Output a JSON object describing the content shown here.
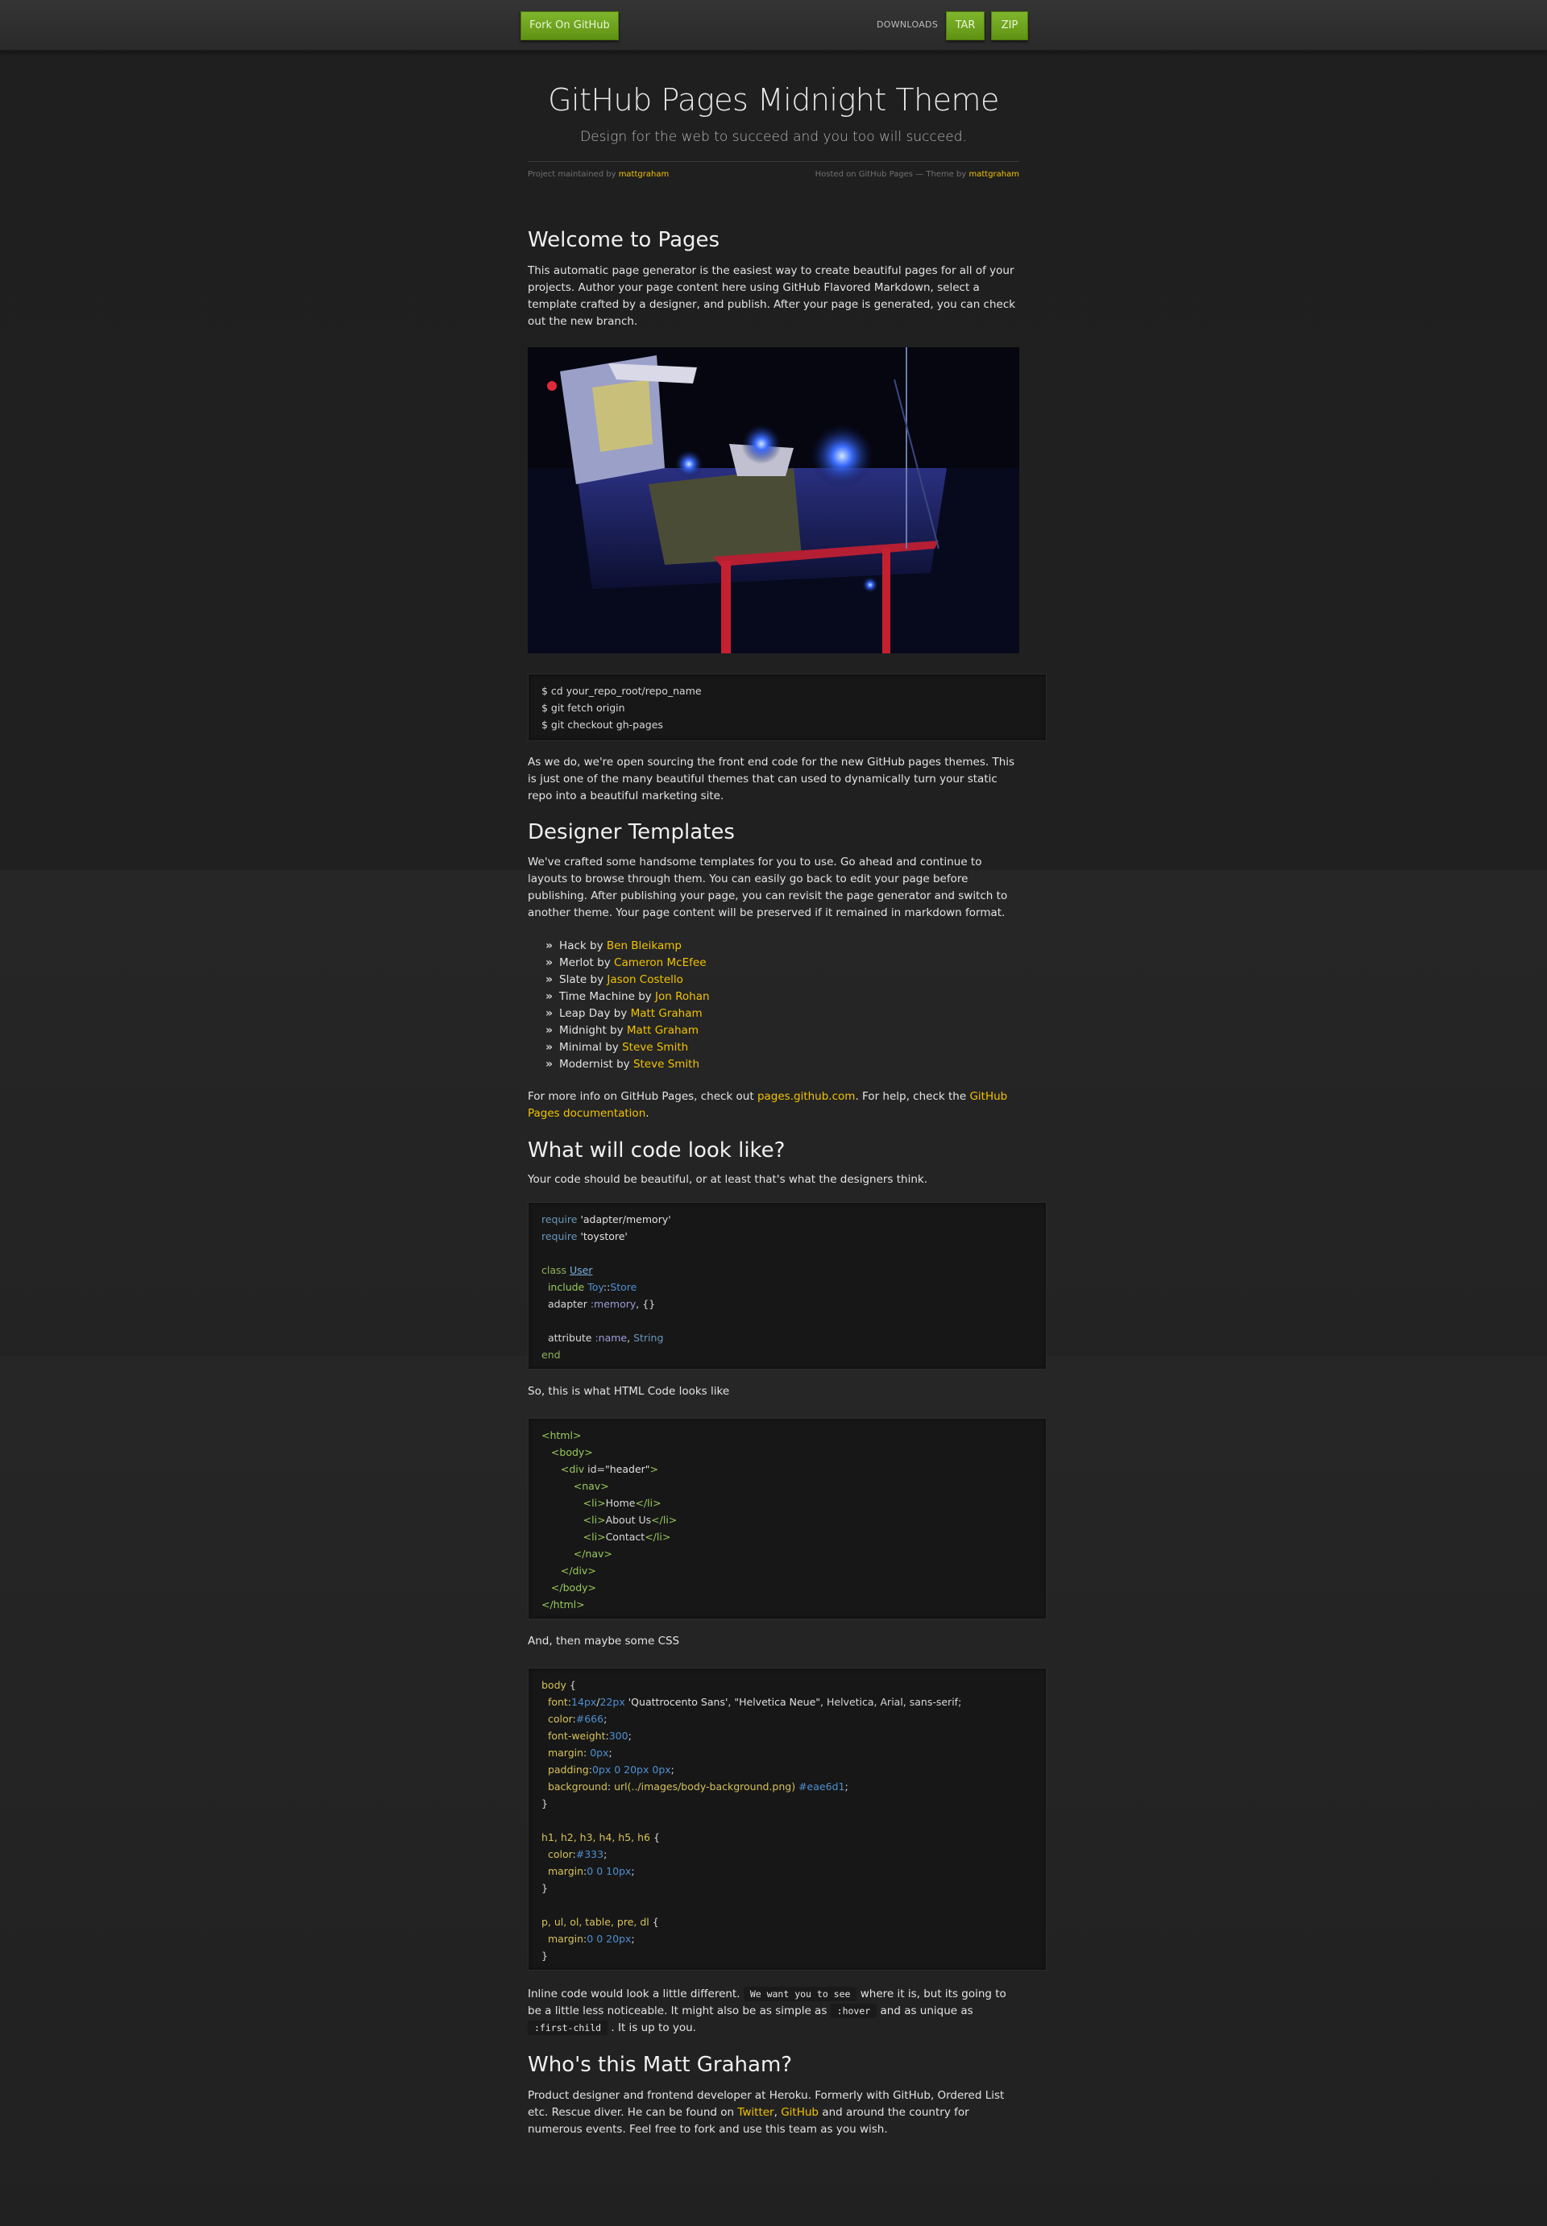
{
  "nav": {
    "fork_label": "Fork On GitHub",
    "downloads_label": "DOWNLOADS",
    "tar_label": "TAR",
    "zip_label": "ZIP"
  },
  "header": {
    "title": "GitHub Pages Midnight Theme",
    "subtitle": "Design for the web to succeed and you too will succeed.",
    "maintained_prefix": "Project maintained by",
    "maintainer": "mattgraham",
    "hosted_text": "Hosted on GitHub Pages — Theme by",
    "theme_author": "mattgraham"
  },
  "welcome": {
    "heading": "Welcome to Pages",
    "body": "This automatic page generator is the easiest way to create beautiful pages for all of your projects. Author your page content here using GitHub Flavored Markdown, select a template crafted by a designer, and publish. After your page is generated, you can check out the new branch."
  },
  "git_commands": [
    "$ cd your_repo_root/repo_name",
    "$ git fetch origin",
    "$ git checkout gh-pages"
  ],
  "open_source_text": "As we do, we're open sourcing the front end code for the new GitHub pages themes. This is just one of the many beautiful themes that can used to dynamically turn your static repo into a beautiful marketing site.",
  "designer": {
    "heading": "Designer Templates",
    "body": "We've crafted some handsome templates for you to use. Go ahead and continue to layouts to browse through them. You can easily go back to edit your page before publishing. After publishing your page, you can revisit the page generator and switch to another theme. Your page content will be preserved if it remained in markdown format.",
    "themes": [
      {
        "name": "Hack",
        "by": "by",
        "author": "Ben Bleikamp"
      },
      {
        "name": "Merlot",
        "by": "by",
        "author": "Cameron McEfee"
      },
      {
        "name": "Slate",
        "by": "by",
        "author": "Jason Costello"
      },
      {
        "name": "Time Machine",
        "by": "by",
        "author": "Jon Rohan"
      },
      {
        "name": "Leap Day",
        "by": "by",
        "author": "Matt Graham"
      },
      {
        "name": "Midnight",
        "by": "by",
        "author": "Matt Graham"
      },
      {
        "name": "Minimal",
        "by": "by",
        "author": "Steve Smith"
      },
      {
        "name": "Modernist",
        "by": "by",
        "author": "Steve Smith"
      }
    ]
  },
  "more_info": {
    "prefix": "For more info on GitHub Pages, check out",
    "link1": "pages.github.com",
    "middle": ". For help, check the",
    "link2": "GitHub Pages documentation",
    "suffix": "."
  },
  "code_section": {
    "heading": "What will code look like?",
    "intro": "Your code should be beautiful, or at least that's what the designers think.",
    "html_intro": "So, this is what HTML Code looks like",
    "css_intro": "And, then maybe some CSS"
  },
  "inline_section": {
    "t1": "Inline code would look a little different.",
    "c1": "We want you to see",
    "t2": "where it is, but its going to be a little less noticeable. It might also be as simple as",
    "c2": ":hover",
    "t3": "and as unique as",
    "c3": ":first-child",
    "t4": ". It is up to you."
  },
  "about": {
    "heading": "Who's this Matt Graham?",
    "body_prefix": "Product designer and frontend developer at Heroku. Formerly with GitHub, Ordered List etc. Rescue diver. He can be found on",
    "link1": "Twitter",
    "sep": ",",
    "link2": "GitHub",
    "body_suffix": "and around the country for numerous events. Feel free to fork and use this team as you wish."
  },
  "colors": {
    "accent_green": "#6fa31e",
    "link_yellow": "#f2c300",
    "background": "#232323"
  }
}
